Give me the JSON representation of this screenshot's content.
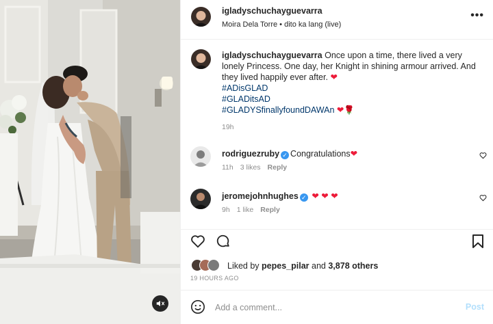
{
  "post": {
    "username": "igladyschuchayguevarra",
    "audio_artist": "Moira Dela Torre",
    "audio_sep": " • ",
    "audio_song": "dito ka lang (live)",
    "more_label": "•••"
  },
  "caption": {
    "username": "igladyschuchayguevarra",
    "text": "Once upon a time, there lived a very lonely Princess. One day, her Knight in shining armour arrived. And they lived happily ever after.",
    "heart": "❤",
    "hashtags": [
      "#ADisGLAD",
      "#GLADitsAD",
      "#GLADYSfinallyfoundDAWAn"
    ],
    "tail_emoji": "❤🌹",
    "time": "19h"
  },
  "comments": [
    {
      "username": "rodriguezruby",
      "verified": true,
      "text": "Congratulations",
      "emoji": "❤",
      "time": "11h",
      "likes": "3 likes",
      "reply": "Reply"
    },
    {
      "username": "jeromejohnhughes",
      "verified": true,
      "text": "",
      "emoji": "❤ ❤ ❤",
      "time": "9h",
      "likes": "1 like",
      "reply": "Reply"
    }
  ],
  "likes": {
    "prefix": "Liked by",
    "first_user": "pepes_pilar",
    "and": "and",
    "others": "3,878 others"
  },
  "date": "19 HOURS AGO",
  "add_comment": {
    "placeholder": "Add a comment...",
    "post_label": "Post"
  },
  "icons": {
    "mute": "speaker-muted-icon",
    "heart": "heart-icon",
    "comment": "comment-icon",
    "save": "bookmark-icon",
    "emoji": "smiley-icon"
  },
  "colors": {
    "hashtag": "#00376b",
    "verified": "#3897f0",
    "heart_red": "#ed1c3a",
    "post_disabled": "#b2dffc"
  }
}
